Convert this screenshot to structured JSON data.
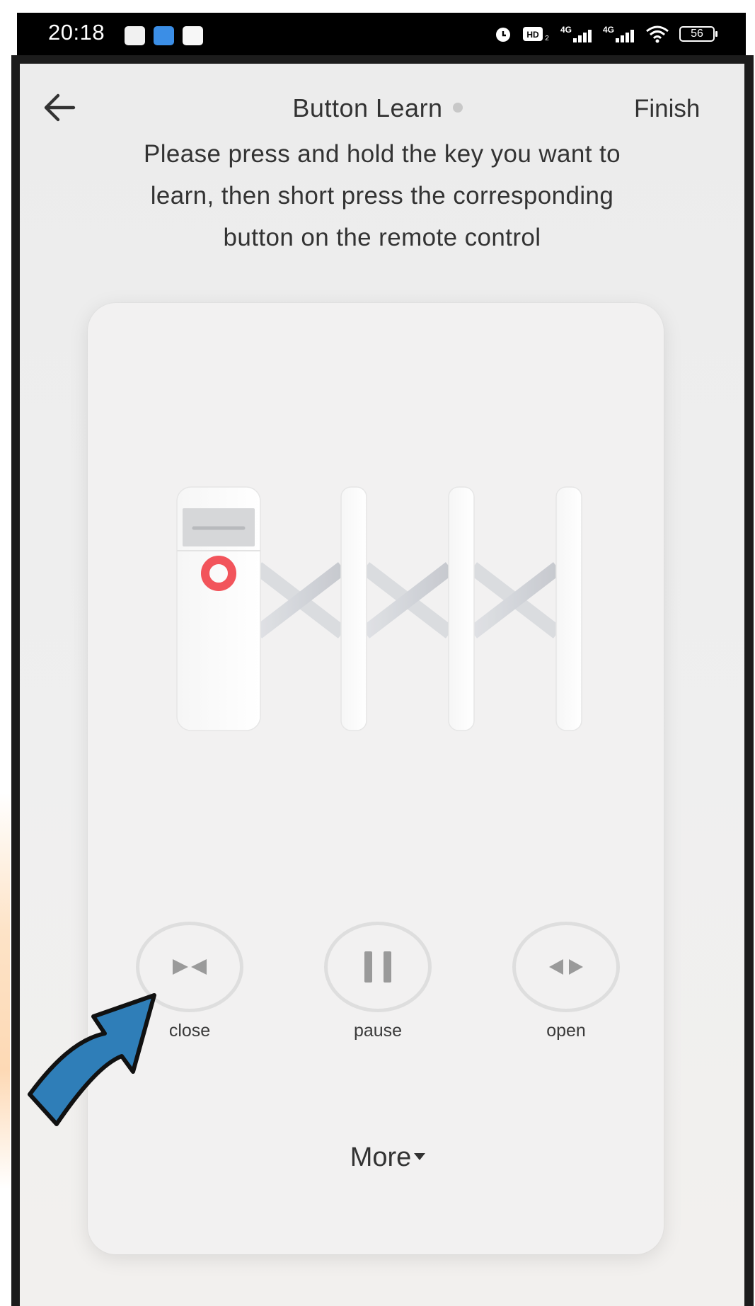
{
  "status_bar": {
    "time": "20:18",
    "battery": "56",
    "icons": [
      "alarm-icon",
      "hd-icon",
      "signal-4g-icon",
      "signal-4g-icon",
      "wifi-icon",
      "battery-icon"
    ]
  },
  "header": {
    "title": "Button Learn",
    "finish_label": "Finish",
    "back_icon": "arrow-left-icon"
  },
  "instructions": "Please press and hold the key you want to learn, then short press the corresponding button on the remote control",
  "controls": {
    "close_label": "close",
    "pause_label": "pause",
    "open_label": "open"
  },
  "more_label": "More",
  "colors": {
    "accent_red": "#f2545b",
    "annotation_arrow": "#2f7eb8",
    "ring": "#dedede"
  }
}
